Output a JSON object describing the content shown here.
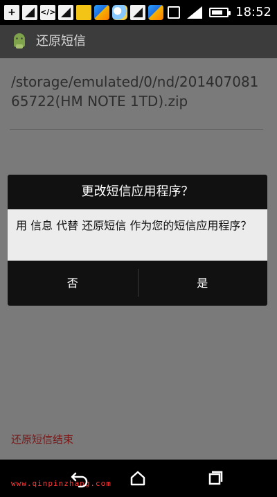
{
  "status_bar": {
    "time": "18:52",
    "battery_level": 0.75,
    "left_icons": [
      {
        "icon": "plus-icon"
      },
      {
        "icon": "signal-notification-icon"
      },
      {
        "icon": "code-icon"
      },
      {
        "icon": "signal-notification-icon"
      },
      {
        "icon": "app-notification-icon"
      },
      {
        "icon": "bird-app-icon"
      },
      {
        "icon": "weather-icon"
      },
      {
        "icon": "signal-notification-icon"
      },
      {
        "icon": "bird-app-icon"
      }
    ],
    "right_icons": [
      "vibrate-icon",
      "signal-icon",
      "battery-icon"
    ]
  },
  "app_bar": {
    "title": "还原短信",
    "icon": "android-icon"
  },
  "content": {
    "file_path": "/storage/emulated/0/nd/20140708165722(HM NOTE 1TD).zip",
    "status": "还原短信结束"
  },
  "dialog": {
    "title": "更改短信应用程序？",
    "message": "用 信息 代替 还原短信 作为您的短信应用程序？",
    "buttons": {
      "no": "否",
      "yes": "是"
    }
  },
  "nav_bar": {
    "watermark": "www.qinpinzhang.com",
    "buttons": [
      "back-icon",
      "home-icon",
      "recent-apps-icon"
    ]
  },
  "colors": {
    "background": "#7a7a7a",
    "app_bar": "#3c3c3c",
    "dialog": "#111111",
    "dialog_message_bg": "#ececec",
    "status_text": "#7a1818",
    "watermark": "#ff3a3a"
  }
}
